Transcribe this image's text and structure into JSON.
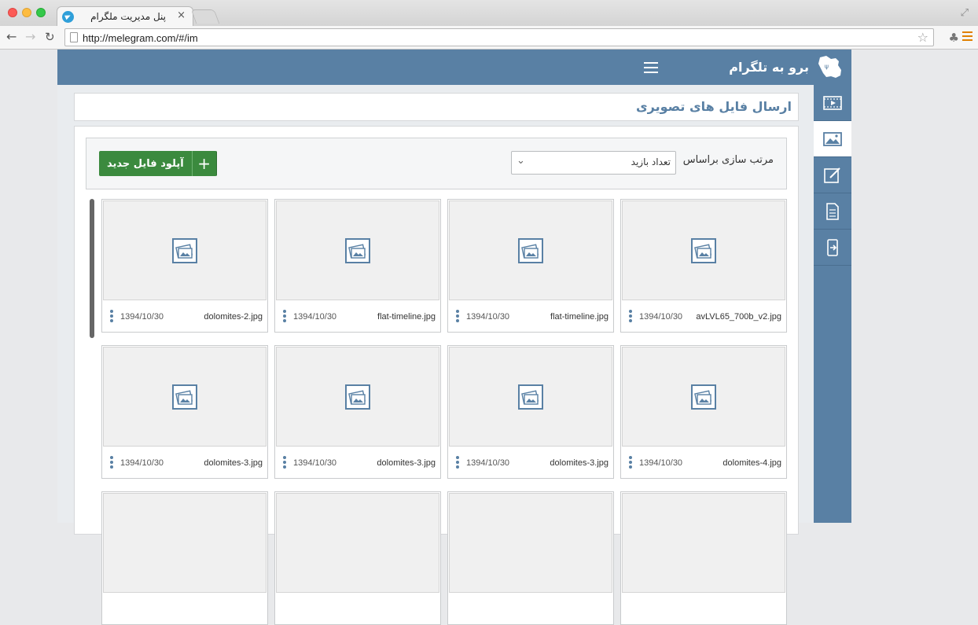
{
  "browser": {
    "tab_title": "پنل مدیریت ملگرام",
    "url": "http://melegram.com/#/im",
    "tab_close": "×"
  },
  "header": {
    "brand": "برو به تلگرام",
    "logo_icon": "iran-map-logo-icon",
    "menu_icon": "hamburger-icon"
  },
  "sidebar": {
    "items": [
      {
        "icon": "video-icon"
      },
      {
        "icon": "image-icon",
        "active": true
      },
      {
        "icon": "edit-icon"
      },
      {
        "icon": "document-icon"
      },
      {
        "icon": "mobile-transfer-icon"
      }
    ]
  },
  "page": {
    "title": "ارسال فایل های تصویری"
  },
  "toolbar": {
    "sort_label": "مرتب سازی براساس",
    "sort_value": "تعداد بازید",
    "upload_label": "آپلود فایل جدید",
    "upload_plus": "+"
  },
  "files": [
    {
      "name": "avLVL65_700b_v2.jpg",
      "date": "1394/10/30"
    },
    {
      "name": "flat-timeline.jpg",
      "date": "1394/10/30"
    },
    {
      "name": "flat-timeline.jpg",
      "date": "1394/10/30"
    },
    {
      "name": "dolomites-2.jpg",
      "date": "1394/10/30"
    },
    {
      "name": "dolomites-4.jpg",
      "date": "1394/10/30"
    },
    {
      "name": "dolomites-3.jpg",
      "date": "1394/10/30"
    },
    {
      "name": "dolomites-3.jpg",
      "date": "1394/10/30"
    },
    {
      "name": "dolomites-3.jpg",
      "date": "1394/10/30"
    }
  ],
  "colors": {
    "primary": "#5980a4",
    "success": "#3b8a3e"
  }
}
